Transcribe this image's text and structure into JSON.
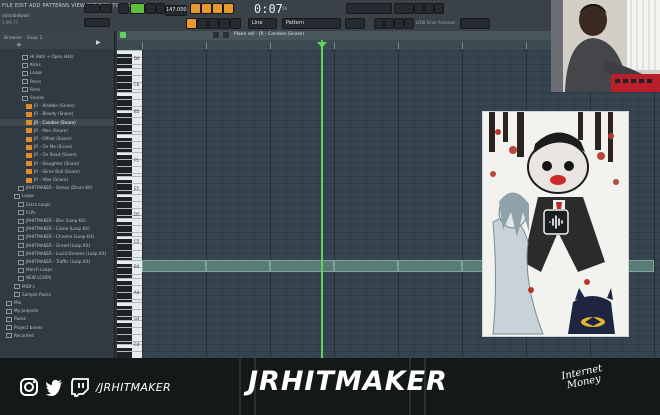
{
  "toolbar": {
    "menu": "FILE EDIT ADD PATTERNS VIEW OPTIONS TOOLS HELP",
    "project_name": "ndssdbdtwolo",
    "project_sub": "5.9M 77",
    "bpm": "147.000",
    "time": "0:07",
    "time_sub": "56",
    "line_label": "Line",
    "pattern_label": "Pattern",
    "monitor_text": "LOW Sinar Assessor"
  },
  "browser": {
    "title": "Browser - Snap 1",
    "items": [
      {
        "label": "Hi Hats + Open Hats",
        "type": "folder"
      },
      {
        "label": "Kicks",
        "type": "folder"
      },
      {
        "label": "Loops",
        "type": "folder"
      },
      {
        "label": "Percs",
        "type": "folder"
      },
      {
        "label": "Rims",
        "type": "folder"
      },
      {
        "label": "Snares",
        "type": "folder"
      },
      {
        "label": "JR - Aladdin (Snare)",
        "type": "sound"
      },
      {
        "label": "JR - Bloody (Snare)",
        "type": "sound"
      },
      {
        "label": "JR - Candies (Snare)",
        "type": "sound",
        "selected": true
      },
      {
        "label": "JR - Man (Snare)",
        "type": "sound"
      },
      {
        "label": "JR - Offset (Snare)",
        "type": "sound"
      },
      {
        "label": "JR - On Me (Snare)",
        "type": "sound"
      },
      {
        "label": "JR - On Road (Snare)",
        "type": "sound"
      },
      {
        "label": "JR - Slaughter (Snare)",
        "type": "sound"
      },
      {
        "label": "JR - Slime Ball (Snare)",
        "type": "sound"
      },
      {
        "label": "JR - Vibe (Snare)",
        "type": "sound"
      },
      {
        "label": "JRHITMAKER - Genus (Drum Kit)",
        "type": "folder"
      },
      {
        "label": "Loops",
        "type": "folder"
      },
      {
        "label": "Extra Loops",
        "type": "folder"
      },
      {
        "label": "FLPs",
        "type": "folder"
      },
      {
        "label": "JRHITMAKER - Blvr (Loop Kit)",
        "type": "folder"
      },
      {
        "label": "JRHITMAKER - Came (Loop Kit)",
        "type": "folder"
      },
      {
        "label": "JRHITMAKER - Chrome (Loop Kit)",
        "type": "folder"
      },
      {
        "label": "JRHITMAKER - Greed (Loop Kit)",
        "type": "folder"
      },
      {
        "label": "JRHITMAKER - Lucid Dreams (Loop Kit)",
        "type": "folder"
      },
      {
        "label": "JRHITMAKER - Traffic (Loop Kit)",
        "type": "folder"
      },
      {
        "label": "March Loops",
        "type": "folder"
      },
      {
        "label": "NEW LOOPS",
        "type": "folder"
      },
      {
        "label": "MIDI's",
        "type": "folder"
      },
      {
        "label": "Sample Packs",
        "type": "folder"
      },
      {
        "label": "Mix",
        "type": "folder"
      },
      {
        "label": "My projects",
        "type": "folder"
      },
      {
        "label": "Packs",
        "type": "folder"
      },
      {
        "label": "Project bones",
        "type": "folder"
      },
      {
        "label": "Recorded",
        "type": "folder"
      }
    ]
  },
  "piano_roll": {
    "title": "Piano roll - JR - Candies (Snare)",
    "key_labels": [
      "D6",
      "C6",
      "B5",
      "F5",
      "E5",
      "D5",
      "C5",
      "B4",
      "A4",
      "G4",
      "C4"
    ]
  },
  "footer": {
    "handle": "/JRHITMAKER",
    "brand": "JRHITMAKER",
    "signature": "Internet Money"
  },
  "colors": {
    "accent_green": "#5fd35a",
    "orange": "#e79a2b",
    "grid_bg": "#364450"
  }
}
